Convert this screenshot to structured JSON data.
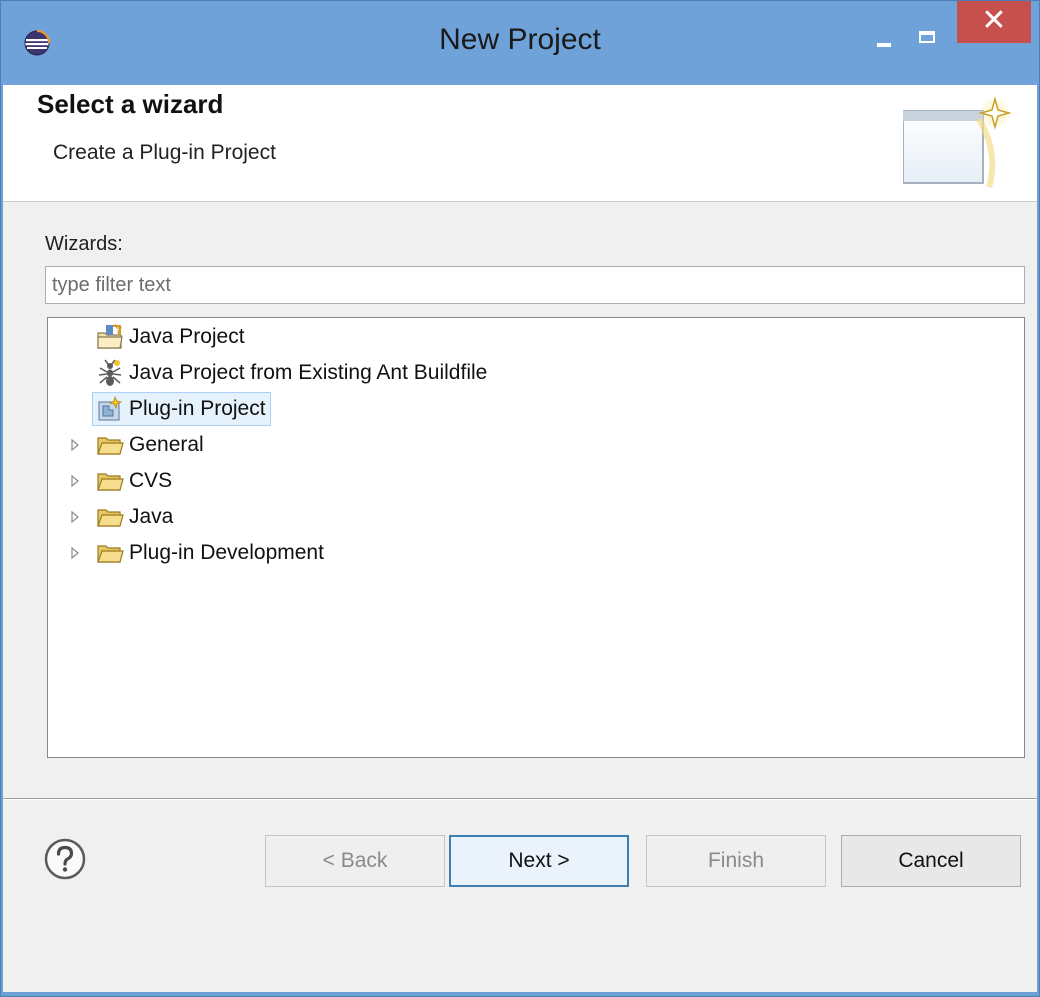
{
  "window": {
    "title": "New Project"
  },
  "header": {
    "title": "Select a wizard",
    "description": "Create a Plug-in Project"
  },
  "wizards": {
    "label": "Wizards:",
    "filter_placeholder": "type filter text",
    "filter_value": ""
  },
  "tree": {
    "items": [
      {
        "label": "Java Project",
        "expandable": false,
        "icon": "java-project-icon",
        "selected": false
      },
      {
        "label": "Java Project from Existing Ant Buildfile",
        "expandable": false,
        "icon": "ant-buildfile-icon",
        "selected": false
      },
      {
        "label": "Plug-in Project",
        "expandable": false,
        "icon": "plugin-project-icon",
        "selected": true
      },
      {
        "label": "General",
        "expandable": true,
        "icon": "folder-icon",
        "selected": false
      },
      {
        "label": "CVS",
        "expandable": true,
        "icon": "folder-icon",
        "selected": false
      },
      {
        "label": "Java",
        "expandable": true,
        "icon": "folder-icon",
        "selected": false
      },
      {
        "label": "Plug-in Development",
        "expandable": true,
        "icon": "folder-icon",
        "selected": false
      }
    ]
  },
  "footer": {
    "back_label": "< Back",
    "next_label": "Next >",
    "finish_label": "Finish",
    "cancel_label": "Cancel"
  },
  "colors": {
    "titlebar": "#6ea2d8",
    "close_button": "#c7504f",
    "selection": "#e5f1fb",
    "default_button_border": "#3c7fb1"
  }
}
